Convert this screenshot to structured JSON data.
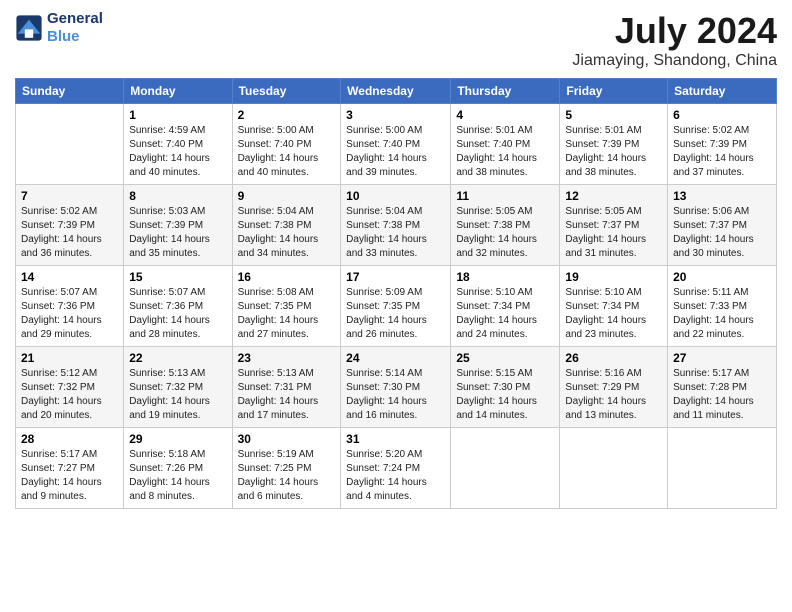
{
  "logo": {
    "line1": "General",
    "line2": "Blue"
  },
  "title": "July 2024",
  "subtitle": "Jiamaying, Shandong, China",
  "weekdays": [
    "Sunday",
    "Monday",
    "Tuesday",
    "Wednesday",
    "Thursday",
    "Friday",
    "Saturday"
  ],
  "weeks": [
    [
      {
        "day": "",
        "sunrise": "",
        "sunset": "",
        "daylight": ""
      },
      {
        "day": "1",
        "sunrise": "4:59 AM",
        "sunset": "7:40 PM",
        "daylight": "14 hours and 40 minutes."
      },
      {
        "day": "2",
        "sunrise": "5:00 AM",
        "sunset": "7:40 PM",
        "daylight": "14 hours and 40 minutes."
      },
      {
        "day": "3",
        "sunrise": "5:00 AM",
        "sunset": "7:40 PM",
        "daylight": "14 hours and 39 minutes."
      },
      {
        "day": "4",
        "sunrise": "5:01 AM",
        "sunset": "7:40 PM",
        "daylight": "14 hours and 38 minutes."
      },
      {
        "day": "5",
        "sunrise": "5:01 AM",
        "sunset": "7:39 PM",
        "daylight": "14 hours and 38 minutes."
      },
      {
        "day": "6",
        "sunrise": "5:02 AM",
        "sunset": "7:39 PM",
        "daylight": "14 hours and 37 minutes."
      }
    ],
    [
      {
        "day": "7",
        "sunrise": "5:02 AM",
        "sunset": "7:39 PM",
        "daylight": "14 hours and 36 minutes."
      },
      {
        "day": "8",
        "sunrise": "5:03 AM",
        "sunset": "7:39 PM",
        "daylight": "14 hours and 35 minutes."
      },
      {
        "day": "9",
        "sunrise": "5:04 AM",
        "sunset": "7:38 PM",
        "daylight": "14 hours and 34 minutes."
      },
      {
        "day": "10",
        "sunrise": "5:04 AM",
        "sunset": "7:38 PM",
        "daylight": "14 hours and 33 minutes."
      },
      {
        "day": "11",
        "sunrise": "5:05 AM",
        "sunset": "7:38 PM",
        "daylight": "14 hours and 32 minutes."
      },
      {
        "day": "12",
        "sunrise": "5:05 AM",
        "sunset": "7:37 PM",
        "daylight": "14 hours and 31 minutes."
      },
      {
        "day": "13",
        "sunrise": "5:06 AM",
        "sunset": "7:37 PM",
        "daylight": "14 hours and 30 minutes."
      }
    ],
    [
      {
        "day": "14",
        "sunrise": "5:07 AM",
        "sunset": "7:36 PM",
        "daylight": "14 hours and 29 minutes."
      },
      {
        "day": "15",
        "sunrise": "5:07 AM",
        "sunset": "7:36 PM",
        "daylight": "14 hours and 28 minutes."
      },
      {
        "day": "16",
        "sunrise": "5:08 AM",
        "sunset": "7:35 PM",
        "daylight": "14 hours and 27 minutes."
      },
      {
        "day": "17",
        "sunrise": "5:09 AM",
        "sunset": "7:35 PM",
        "daylight": "14 hours and 26 minutes."
      },
      {
        "day": "18",
        "sunrise": "5:10 AM",
        "sunset": "7:34 PM",
        "daylight": "14 hours and 24 minutes."
      },
      {
        "day": "19",
        "sunrise": "5:10 AM",
        "sunset": "7:34 PM",
        "daylight": "14 hours and 23 minutes."
      },
      {
        "day": "20",
        "sunrise": "5:11 AM",
        "sunset": "7:33 PM",
        "daylight": "14 hours and 22 minutes."
      }
    ],
    [
      {
        "day": "21",
        "sunrise": "5:12 AM",
        "sunset": "7:32 PM",
        "daylight": "14 hours and 20 minutes."
      },
      {
        "day": "22",
        "sunrise": "5:13 AM",
        "sunset": "7:32 PM",
        "daylight": "14 hours and 19 minutes."
      },
      {
        "day": "23",
        "sunrise": "5:13 AM",
        "sunset": "7:31 PM",
        "daylight": "14 hours and 17 minutes."
      },
      {
        "day": "24",
        "sunrise": "5:14 AM",
        "sunset": "7:30 PM",
        "daylight": "14 hours and 16 minutes."
      },
      {
        "day": "25",
        "sunrise": "5:15 AM",
        "sunset": "7:30 PM",
        "daylight": "14 hours and 14 minutes."
      },
      {
        "day": "26",
        "sunrise": "5:16 AM",
        "sunset": "7:29 PM",
        "daylight": "14 hours and 13 minutes."
      },
      {
        "day": "27",
        "sunrise": "5:17 AM",
        "sunset": "7:28 PM",
        "daylight": "14 hours and 11 minutes."
      }
    ],
    [
      {
        "day": "28",
        "sunrise": "5:17 AM",
        "sunset": "7:27 PM",
        "daylight": "14 hours and 9 minutes."
      },
      {
        "day": "29",
        "sunrise": "5:18 AM",
        "sunset": "7:26 PM",
        "daylight": "14 hours and 8 minutes."
      },
      {
        "day": "30",
        "sunrise": "5:19 AM",
        "sunset": "7:25 PM",
        "daylight": "14 hours and 6 minutes."
      },
      {
        "day": "31",
        "sunrise": "5:20 AM",
        "sunset": "7:24 PM",
        "daylight": "14 hours and 4 minutes."
      },
      {
        "day": "",
        "sunrise": "",
        "sunset": "",
        "daylight": ""
      },
      {
        "day": "",
        "sunrise": "",
        "sunset": "",
        "daylight": ""
      },
      {
        "day": "",
        "sunrise": "",
        "sunset": "",
        "daylight": ""
      }
    ]
  ],
  "labels": {
    "sunrise": "Sunrise:",
    "sunset": "Sunset:",
    "daylight": "Daylight: 14 hours"
  }
}
